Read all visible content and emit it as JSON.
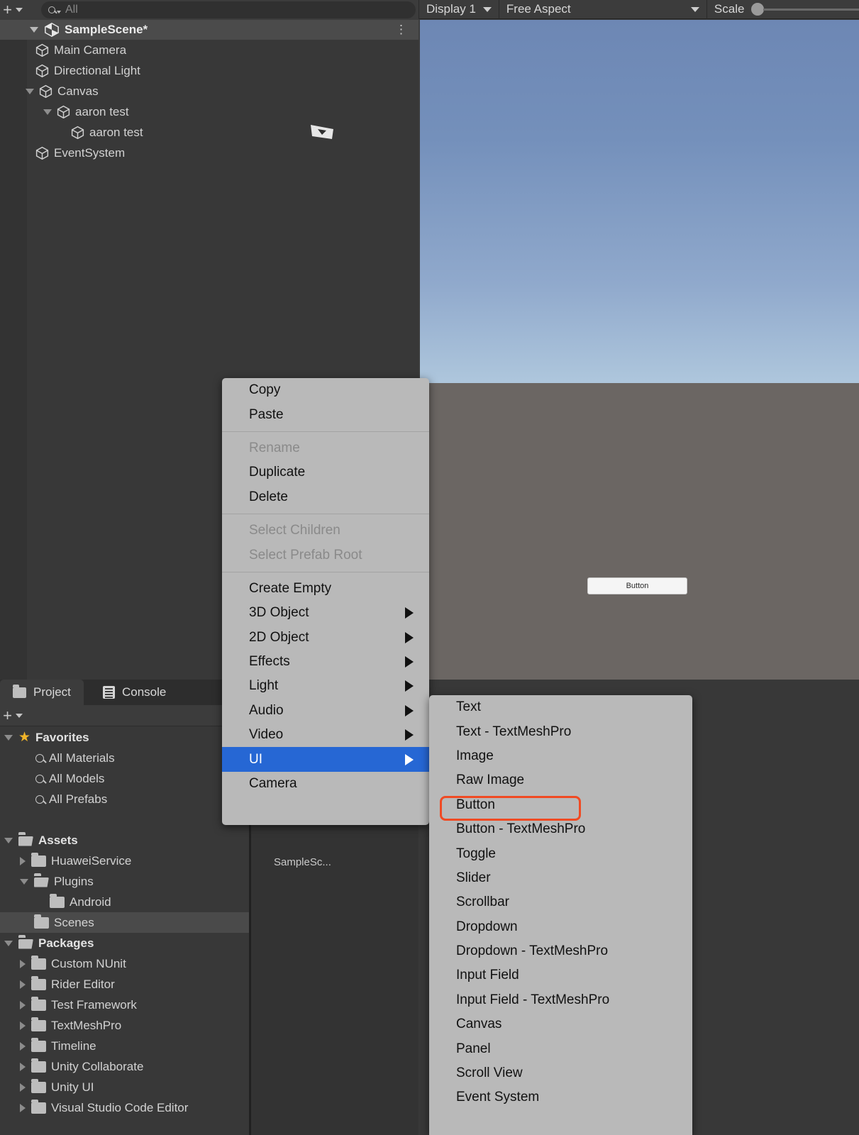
{
  "hierarchy": {
    "toolbar": {
      "add_label": "+",
      "search_placeholder": "All",
      "search_value": ""
    },
    "scene": {
      "name": "SampleScene*",
      "kebab": "⋮"
    },
    "items": [
      {
        "label": "Main Camera",
        "depth": 1,
        "expander": "none"
      },
      {
        "label": "Directional Light",
        "depth": 1,
        "expander": "none"
      },
      {
        "label": "Canvas",
        "depth": 1,
        "expander": "down"
      },
      {
        "label": "aaron test",
        "depth": 2,
        "expander": "down"
      },
      {
        "label": "aaron test",
        "depth": 3,
        "expander": "none"
      },
      {
        "label": "EventSystem",
        "depth": 1,
        "expander": "none"
      }
    ]
  },
  "gameview": {
    "display": "Display 1",
    "aspect": "Free Aspect",
    "scale_label": "Scale",
    "scale_value": 1,
    "button_label": "Button"
  },
  "project": {
    "tabs": [
      {
        "label": "Project",
        "icon": "folder-icon",
        "active": true
      },
      {
        "label": "Console",
        "icon": "console-icon",
        "active": false
      }
    ],
    "toolbar": {
      "add_label": "+"
    },
    "rows": [
      {
        "label": "Favorites",
        "depth": 0,
        "expander": "down",
        "icon": "star",
        "bold": true,
        "selected": false
      },
      {
        "label": "All Materials",
        "depth": 1,
        "expander": "none",
        "icon": "search",
        "bold": false,
        "selected": false
      },
      {
        "label": "All Models",
        "depth": 1,
        "expander": "none",
        "icon": "search",
        "bold": false,
        "selected": false
      },
      {
        "label": "All Prefabs",
        "depth": 1,
        "expander": "none",
        "icon": "search",
        "bold": false,
        "selected": false
      },
      {
        "label": "",
        "depth": 0,
        "expander": "none",
        "icon": "none",
        "bold": false,
        "selected": false
      },
      {
        "label": "Assets",
        "depth": 0,
        "expander": "down",
        "icon": "folder-open",
        "bold": true,
        "selected": false
      },
      {
        "label": "HuaweiService",
        "depth": 1,
        "expander": "right",
        "icon": "folder",
        "bold": false,
        "selected": false
      },
      {
        "label": "Plugins",
        "depth": 1,
        "expander": "down",
        "icon": "folder-open",
        "bold": false,
        "selected": false
      },
      {
        "label": "Android",
        "depth": 2,
        "expander": "none",
        "icon": "folder",
        "bold": false,
        "selected": false
      },
      {
        "label": "Scenes",
        "depth": 1,
        "expander": "none",
        "icon": "folder",
        "bold": false,
        "selected": true
      },
      {
        "label": "Packages",
        "depth": 0,
        "expander": "down",
        "icon": "folder-open",
        "bold": true,
        "selected": false
      },
      {
        "label": "Custom NUnit",
        "depth": 1,
        "expander": "right",
        "icon": "folder",
        "bold": false,
        "selected": false
      },
      {
        "label": "Rider Editor",
        "depth": 1,
        "expander": "right",
        "icon": "folder",
        "bold": false,
        "selected": false
      },
      {
        "label": "Test Framework",
        "depth": 1,
        "expander": "right",
        "icon": "folder",
        "bold": false,
        "selected": false
      },
      {
        "label": "TextMeshPro",
        "depth": 1,
        "expander": "right",
        "icon": "folder",
        "bold": false,
        "selected": false
      },
      {
        "label": "Timeline",
        "depth": 1,
        "expander": "right",
        "icon": "folder",
        "bold": false,
        "selected": false
      },
      {
        "label": "Unity Collaborate",
        "depth": 1,
        "expander": "right",
        "icon": "folder",
        "bold": false,
        "selected": false
      },
      {
        "label": "Unity UI",
        "depth": 1,
        "expander": "right",
        "icon": "folder",
        "bold": false,
        "selected": false
      },
      {
        "label": "Visual Studio Code Editor",
        "depth": 1,
        "expander": "right",
        "icon": "folder",
        "bold": false,
        "selected": false
      }
    ],
    "asset_label": "SampleSc..."
  },
  "context_menu": {
    "items": [
      {
        "label": "Copy",
        "disabled": false,
        "submenu": false,
        "highlight": false
      },
      {
        "label": "Paste",
        "disabled": false,
        "submenu": false,
        "highlight": false
      },
      {
        "separator": true
      },
      {
        "label": "Rename",
        "disabled": true,
        "submenu": false,
        "highlight": false
      },
      {
        "label": "Duplicate",
        "disabled": false,
        "submenu": false,
        "highlight": false
      },
      {
        "label": "Delete",
        "disabled": false,
        "submenu": false,
        "highlight": false
      },
      {
        "separator": true
      },
      {
        "label": "Select Children",
        "disabled": true,
        "submenu": false,
        "highlight": false
      },
      {
        "label": "Select Prefab Root",
        "disabled": true,
        "submenu": false,
        "highlight": false
      },
      {
        "separator": true
      },
      {
        "label": "Create Empty",
        "disabled": false,
        "submenu": false,
        "highlight": false
      },
      {
        "label": "3D Object",
        "disabled": false,
        "submenu": true,
        "highlight": false
      },
      {
        "label": "2D Object",
        "disabled": false,
        "submenu": true,
        "highlight": false
      },
      {
        "label": "Effects",
        "disabled": false,
        "submenu": true,
        "highlight": false
      },
      {
        "label": "Light",
        "disabled": false,
        "submenu": true,
        "highlight": false
      },
      {
        "label": "Audio",
        "disabled": false,
        "submenu": true,
        "highlight": false
      },
      {
        "label": "Video",
        "disabled": false,
        "submenu": true,
        "highlight": false
      },
      {
        "label": "UI",
        "disabled": false,
        "submenu": true,
        "highlight": true
      },
      {
        "label": "Camera",
        "disabled": false,
        "submenu": false,
        "highlight": false
      }
    ]
  },
  "submenu": {
    "items": [
      {
        "label": "Text",
        "ringed": false
      },
      {
        "label": "Text - TextMeshPro",
        "ringed": false
      },
      {
        "label": "Image",
        "ringed": false
      },
      {
        "label": "Raw Image",
        "ringed": false
      },
      {
        "label": "Button",
        "ringed": true
      },
      {
        "label": "Button - TextMeshPro",
        "ringed": false
      },
      {
        "label": "Toggle",
        "ringed": false
      },
      {
        "label": "Slider",
        "ringed": false
      },
      {
        "label": "Scrollbar",
        "ringed": false
      },
      {
        "label": "Dropdown",
        "ringed": false
      },
      {
        "label": "Dropdown - TextMeshPro",
        "ringed": false
      },
      {
        "label": "Input Field",
        "ringed": false
      },
      {
        "label": "Input Field - TextMeshPro",
        "ringed": false
      },
      {
        "label": "Canvas",
        "ringed": false
      },
      {
        "label": "Panel",
        "ringed": false
      },
      {
        "label": "Scroll View",
        "ringed": false
      },
      {
        "label": "Event System",
        "ringed": false
      }
    ]
  },
  "colors": {
    "accent_blue": "#2667d4",
    "highlight_ring": "#f04a23",
    "panel_bg": "#383838",
    "menu_bg": "#b9b9b9"
  }
}
